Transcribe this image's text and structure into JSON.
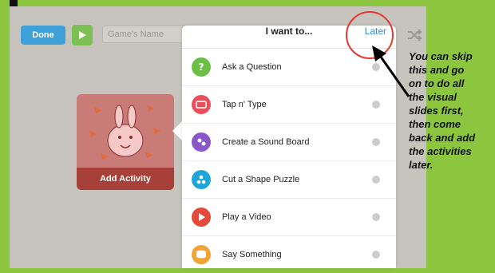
{
  "toolbar": {
    "done_label": "Done",
    "name_placeholder": "Game's Name"
  },
  "card": {
    "label": "Add Activity"
  },
  "popover": {
    "title": "I want to...",
    "later_label": "Later",
    "items": [
      {
        "label": "Ask a Question",
        "icon": "question-icon",
        "color": "#6cbf44"
      },
      {
        "label": "Tap n' Type",
        "icon": "keyboard-icon",
        "color": "#e84f5a"
      },
      {
        "label": "Create a Sound Board",
        "icon": "soundboard-icon",
        "color": "#8a57c7"
      },
      {
        "label": "Cut a Shape Puzzle",
        "icon": "puzzle-icon",
        "color": "#1ea6d9"
      },
      {
        "label": "Play a Video",
        "icon": "play-icon",
        "color": "#e24b3b"
      },
      {
        "label": "Say Something",
        "icon": "speech-icon",
        "color": "#f2a335"
      }
    ]
  },
  "annotation": {
    "text": "You can skip\nthis and go\non to do all\nthe visual\nslides first,\nthen come\nback and add\nthe activities\nlater."
  },
  "colors": {
    "background": "#8cc63f",
    "accent": "#2f8fdc",
    "annotation_red": "#e23a2f"
  }
}
